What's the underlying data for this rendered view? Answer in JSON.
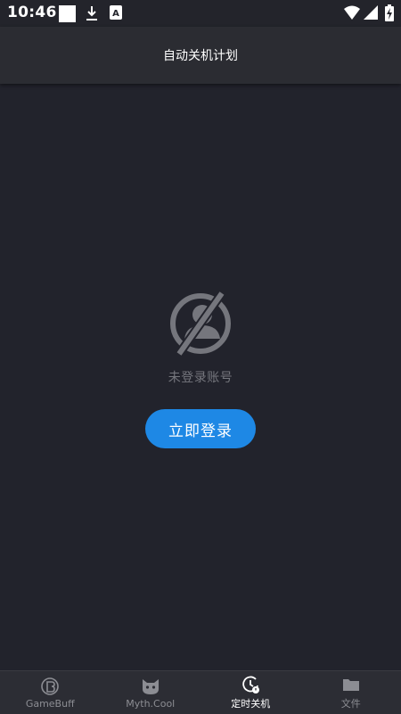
{
  "status_bar": {
    "time": "10:46"
  },
  "app_bar": {
    "title": "自动关机计划"
  },
  "empty_state": {
    "message": "未登录账号",
    "login_button": "立即登录"
  },
  "tabs": [
    {
      "label": "GameBuff",
      "icon": "gamebuff-logo-icon",
      "active": false
    },
    {
      "label": "Myth.Cool",
      "icon": "cat-face-icon",
      "active": false
    },
    {
      "label": "定时关机",
      "icon": "timer-icon",
      "active": true
    },
    {
      "label": "文件",
      "icon": "folder-icon",
      "active": false
    }
  ],
  "colors": {
    "background": "#22232c",
    "accent": "#1e88e5",
    "muted_text": "#75767d"
  }
}
